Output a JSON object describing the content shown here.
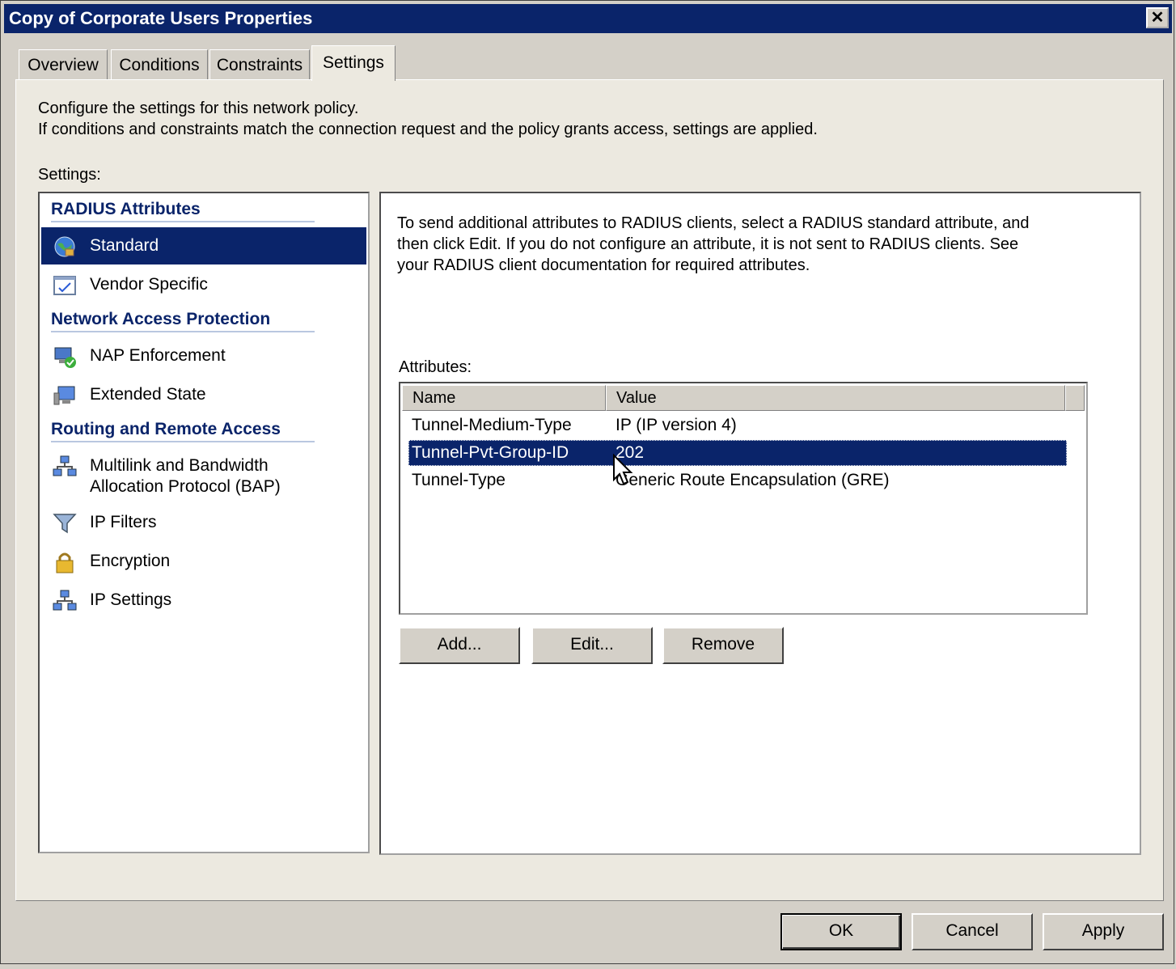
{
  "window": {
    "title": "Copy of Corporate Users Properties",
    "close_glyph": "✕"
  },
  "tabs": [
    "Overview",
    "Conditions",
    "Constraints",
    "Settings"
  ],
  "active_tab": "Settings",
  "description": {
    "line1": "Configure the settings for this network policy.",
    "line2": "If conditions and constraints match the connection request and the policy grants access, settings are applied."
  },
  "settings_label": "Settings:",
  "sidebar": {
    "sections": [
      {
        "heading": "RADIUS Attributes",
        "items": [
          {
            "label": "Standard",
            "icon": "globe-icon",
            "selected": true
          },
          {
            "label": "Vendor Specific",
            "icon": "checklist-icon",
            "selected": false
          }
        ]
      },
      {
        "heading": "Network Access Protection",
        "items": [
          {
            "label": "NAP Enforcement",
            "icon": "computer-check-icon",
            "selected": false
          },
          {
            "label": "Extended State",
            "icon": "monitor-icon",
            "selected": false
          }
        ]
      },
      {
        "heading": "Routing and Remote Access",
        "items": [
          {
            "label": "Multilink and Bandwidth",
            "label2": "Allocation Protocol (BAP)",
            "icon": "network-icon",
            "selected": false
          },
          {
            "label": "IP Filters",
            "icon": "funnel-icon",
            "selected": false
          },
          {
            "label": "Encryption",
            "icon": "lock-icon",
            "selected": false
          },
          {
            "label": "IP Settings",
            "icon": "network-icon",
            "selected": false
          }
        ]
      }
    ]
  },
  "detail": {
    "info_line1": "To send additional attributes to RADIUS clients, select a RADIUS standard attribute, and",
    "info_line2": "then click Edit. If you do not configure an attribute, it is not sent to RADIUS clients. See",
    "info_line3": "your RADIUS client documentation for required attributes.",
    "attributes_label": "Attributes:",
    "columns": [
      "Name",
      "Value"
    ],
    "rows": [
      {
        "name": "Tunnel-Medium-Type",
        "value": "IP (IP version 4)",
        "selected": false
      },
      {
        "name": "Tunnel-Pvt-Group-ID",
        "value": "202",
        "selected": true
      },
      {
        "name": "Tunnel-Type",
        "value": "Generic Route Encapsulation (GRE)",
        "selected": false
      }
    ],
    "buttons": {
      "add": "Add...",
      "edit": "Edit...",
      "remove": "Remove"
    }
  },
  "footer_buttons": {
    "ok": "OK",
    "cancel": "Cancel",
    "apply": "Apply"
  },
  "colors": {
    "selection": "#0a246a",
    "titlebar": "#0a246a",
    "heading": "#0a246a"
  }
}
